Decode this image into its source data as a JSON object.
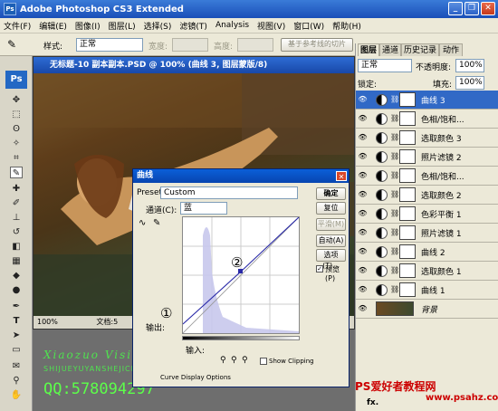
{
  "app": {
    "title": "Adobe Photoshop CS3 Extended",
    "icon": "Ps"
  },
  "window_buttons": {
    "minimize": "_",
    "restore": "❐",
    "close": "✕"
  },
  "menu": [
    "文件(F)",
    "编辑(E)",
    "图像(I)",
    "图层(L)",
    "选择(S)",
    "滤镜(T)",
    "Analysis",
    "视图(V)",
    "窗口(W)",
    "帮助(H)"
  ],
  "options": {
    "style_label": "样式:",
    "style_value": "正常",
    "width_label": "宽度:",
    "height_label": "高度:",
    "refine_button": "基于参考线的切片"
  },
  "document": {
    "title": "无标题-10 副本副本.PSD @ 100% (曲线 3, 图层蒙版/8)",
    "zoom": "100%",
    "status": "文档:5"
  },
  "watermark": {
    "line1": "Xiaozuo Vision",
    "line2": "SHIJUEYUYANSHEJICHUANGYI",
    "line3": "QQ:578094297"
  },
  "layers_panel": {
    "tabs": [
      "图层",
      "通道",
      "历史记录",
      "动作"
    ],
    "blend_mode": "正常",
    "opacity_label": "不透明度:",
    "opacity_value": "100%",
    "lock_label": "锁定:",
    "fill_label": "填充:",
    "fill_value": "100%",
    "layers": [
      {
        "name": "曲线 3",
        "selected": true
      },
      {
        "name": "色相/饱和...",
        "selected": false
      },
      {
        "name": "选取颜色 3",
        "selected": false
      },
      {
        "name": "照片滤镜 2",
        "selected": false
      },
      {
        "name": "色相/饱和...",
        "selected": false
      },
      {
        "name": "选取颜色 2",
        "selected": false
      },
      {
        "name": "色彩平衡 1",
        "selected": false
      },
      {
        "name": "照片滤镜 1",
        "selected": false
      },
      {
        "name": "曲线 2",
        "selected": false
      },
      {
        "name": "选取颜色 1",
        "selected": false
      },
      {
        "name": "曲线 1",
        "selected": false
      },
      {
        "name": "背景",
        "selected": false
      }
    ],
    "bottom_icons": "fx."
  },
  "curves_dialog": {
    "title": "曲线",
    "preset_label": "Preset:",
    "preset_value": "Custom",
    "channel_label": "通道(C):",
    "channel_value": "蓝",
    "output_label": "输出:",
    "input_label": "输入:",
    "ok": "确定",
    "cancel": "复位",
    "smooth": "平滑(M)",
    "auto": "自动(A)",
    "options": "选项(T)...",
    "preview": "预览(P)",
    "show_clipping": "Show Clipping",
    "curve_display_options": "Curve Display Options",
    "marker1": "①",
    "marker2": "②"
  },
  "branding": {
    "site_cn": "PS爱好者教程网",
    "site_url": "www.psahz.com"
  }
}
